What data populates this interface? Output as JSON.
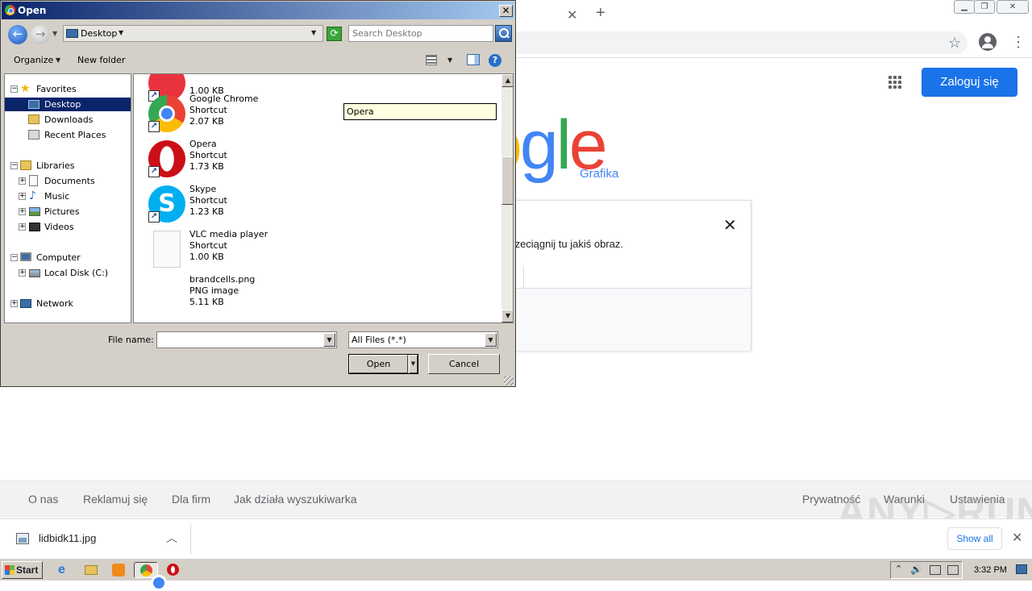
{
  "browser": {
    "signin_label": "Zaloguj się",
    "logo_text": "Google",
    "logo_visible": [
      "o",
      "g",
      "l",
      "e"
    ],
    "logo_sub": "Grafika",
    "upload_card": {
      "drop_text": "stu. Przeciągnij tu jakiś obraz."
    },
    "footer_left": [
      "O nas",
      "Reklamuj się",
      "Dla firm",
      "Jak działa wyszukiwarka"
    ],
    "footer_right": [
      "Prywatność",
      "Warunki",
      "Ustawienia"
    ],
    "download": {
      "file_name": "lidbidk11.jpg",
      "show_all": "Show all"
    },
    "watermark": "ANY.RUN"
  },
  "taskbar": {
    "start_label": "Start",
    "clock": "3:32 PM",
    "icons": [
      "ie-icon",
      "explorer-icon",
      "media-player-icon",
      "chrome-icon",
      "opera-icon"
    ]
  },
  "dialog": {
    "title": "Open",
    "address": "Desktop",
    "search_placeholder": "Search Desktop",
    "toolbar": {
      "organize": "Organize",
      "new_folder": "New folder"
    },
    "tree": [
      {
        "label": "Favorites",
        "level": 0,
        "icon": "star-icon",
        "expander": "−"
      },
      {
        "label": "Desktop",
        "level": 1,
        "icon": "desktop-icon",
        "selected": true
      },
      {
        "label": "Downloads",
        "level": 1,
        "icon": "downloads-icon"
      },
      {
        "label": "Recent Places",
        "level": 1,
        "icon": "recent-places-icon"
      },
      {
        "label": "Libraries",
        "level": 0,
        "icon": "libraries-icon",
        "expander": "−"
      },
      {
        "label": "Documents",
        "level": 1,
        "icon": "documents-icon",
        "expander": "+"
      },
      {
        "label": "Music",
        "level": 1,
        "icon": "music-icon",
        "expander": "+"
      },
      {
        "label": "Pictures",
        "level": 1,
        "icon": "pictures-icon",
        "expander": "+"
      },
      {
        "label": "Videos",
        "level": 1,
        "icon": "videos-icon",
        "expander": "+"
      },
      {
        "label": "Computer",
        "level": 0,
        "icon": "computer-icon",
        "expander": "−"
      },
      {
        "label": "Local Disk (C:)",
        "level": 1,
        "icon": "disk-icon",
        "expander": "+"
      },
      {
        "label": "Network",
        "level": 0,
        "icon": "network-icon",
        "expander": "+"
      }
    ],
    "files": [
      {
        "name": "",
        "type": "",
        "size": "1.00 KB",
        "icon": "red-app-icon",
        "shortcut": true
      },
      {
        "name": "Google Chrome",
        "type": "Shortcut",
        "size": "2.07 KB",
        "icon": "chrome-icon",
        "shortcut": true
      },
      {
        "name": "Opera",
        "type": "Shortcut",
        "size": "1.73 KB",
        "icon": "opera-icon",
        "shortcut": true
      },
      {
        "name": "Skype",
        "type": "Shortcut",
        "size": "1.23 KB",
        "icon": "skype-icon",
        "shortcut": true
      },
      {
        "name": "VLC media player",
        "type": "Shortcut",
        "size": "1.00 KB",
        "icon": "blank-file-icon",
        "shortcut": false
      },
      {
        "name": "brandcells.png",
        "type": "PNG image",
        "size": "5.11 KB",
        "icon": "none",
        "shortcut": false
      }
    ],
    "tooltip": "Opera",
    "file_name_label": "File name:",
    "file_name_value": "",
    "filter": "All Files (*.*)",
    "open_label": "Open",
    "cancel_label": "Cancel"
  }
}
